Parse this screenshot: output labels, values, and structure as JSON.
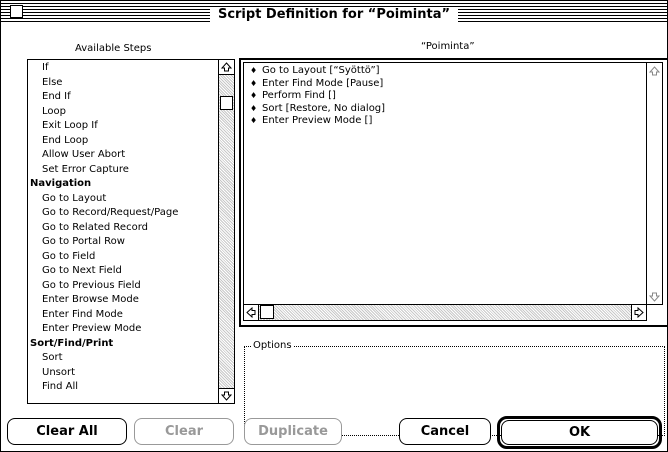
{
  "window": {
    "title": "Script Definition for “Poiminta”"
  },
  "available_steps": {
    "heading": "Available Steps",
    "items": [
      {
        "label": "If",
        "type": "item"
      },
      {
        "label": "Else",
        "type": "item"
      },
      {
        "label": "End If",
        "type": "item"
      },
      {
        "label": "Loop",
        "type": "item"
      },
      {
        "label": "Exit Loop If",
        "type": "item"
      },
      {
        "label": "End Loop",
        "type": "item"
      },
      {
        "label": "Allow User Abort",
        "type": "item"
      },
      {
        "label": "Set Error Capture",
        "type": "item"
      },
      {
        "label": "Navigation",
        "type": "category"
      },
      {
        "label": "Go to Layout",
        "type": "item"
      },
      {
        "label": "Go to Record/Request/Page",
        "type": "item"
      },
      {
        "label": "Go to Related Record",
        "type": "item"
      },
      {
        "label": "Go to Portal Row",
        "type": "item"
      },
      {
        "label": "Go to Field",
        "type": "item"
      },
      {
        "label": "Go to Next Field",
        "type": "item"
      },
      {
        "label": "Go to Previous Field",
        "type": "item"
      },
      {
        "label": "Enter Browse Mode",
        "type": "item"
      },
      {
        "label": "Enter Find Mode",
        "type": "item"
      },
      {
        "label": "Enter Preview Mode",
        "type": "item"
      },
      {
        "label": "Sort/Find/Print",
        "type": "category"
      },
      {
        "label": "Sort",
        "type": "item"
      },
      {
        "label": "Unsort",
        "type": "item"
      },
      {
        "label": "Find All",
        "type": "item"
      }
    ]
  },
  "script": {
    "heading": "“Poiminta”",
    "steps": [
      "Go to Layout [“Syöttö”]",
      "Enter Find Mode [Pause]",
      "Perform Find []",
      "Sort [Restore, No dialog]",
      "Enter Preview Mode []"
    ]
  },
  "options": {
    "label": "Options"
  },
  "buttons": {
    "clear_all": "Clear All",
    "clear": "Clear",
    "duplicate": "Duplicate",
    "cancel": "Cancel",
    "ok": "OK"
  },
  "icons": {
    "up_arrow": "up-arrow-icon",
    "down_arrow": "down-arrow-icon",
    "left_arrow": "left-arrow-icon",
    "right_arrow": "right-arrow-icon",
    "diamond": "move-handle-icon"
  }
}
